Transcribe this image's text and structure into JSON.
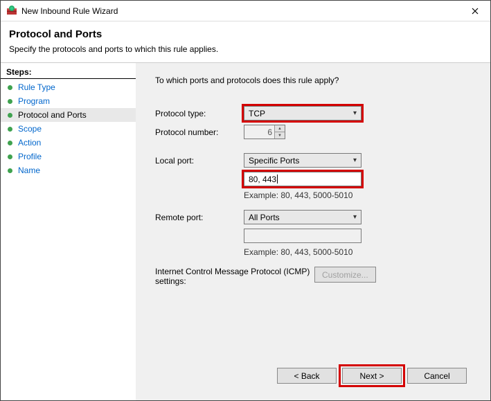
{
  "window": {
    "title": "New Inbound Rule Wizard"
  },
  "header": {
    "title": "Protocol and Ports",
    "subtitle": "Specify the protocols and ports to which this rule applies."
  },
  "sidebar": {
    "title": "Steps:",
    "items": [
      {
        "label": "Rule Type"
      },
      {
        "label": "Program"
      },
      {
        "label": "Protocol and Ports"
      },
      {
        "label": "Scope"
      },
      {
        "label": "Action"
      },
      {
        "label": "Profile"
      },
      {
        "label": "Name"
      }
    ],
    "active_index": 2
  },
  "content": {
    "question": "To which ports and protocols does this rule apply?",
    "protocol_type_label": "Protocol type:",
    "protocol_type_value": "TCP",
    "protocol_number_label": "Protocol number:",
    "protocol_number_value": "6",
    "local_port_label": "Local port:",
    "local_port_select": "Specific Ports",
    "local_port_value": "80, 443",
    "local_port_example": "Example: 80, 443, 5000-5010",
    "remote_port_label": "Remote port:",
    "remote_port_select": "All Ports",
    "remote_port_value": "",
    "remote_port_example": "Example: 80, 443, 5000-5010",
    "icmp_label": "Internet Control Message Protocol (ICMP) settings:",
    "customize_label": "Customize..."
  },
  "footer": {
    "back": "< Back",
    "next": "Next >",
    "cancel": "Cancel"
  }
}
